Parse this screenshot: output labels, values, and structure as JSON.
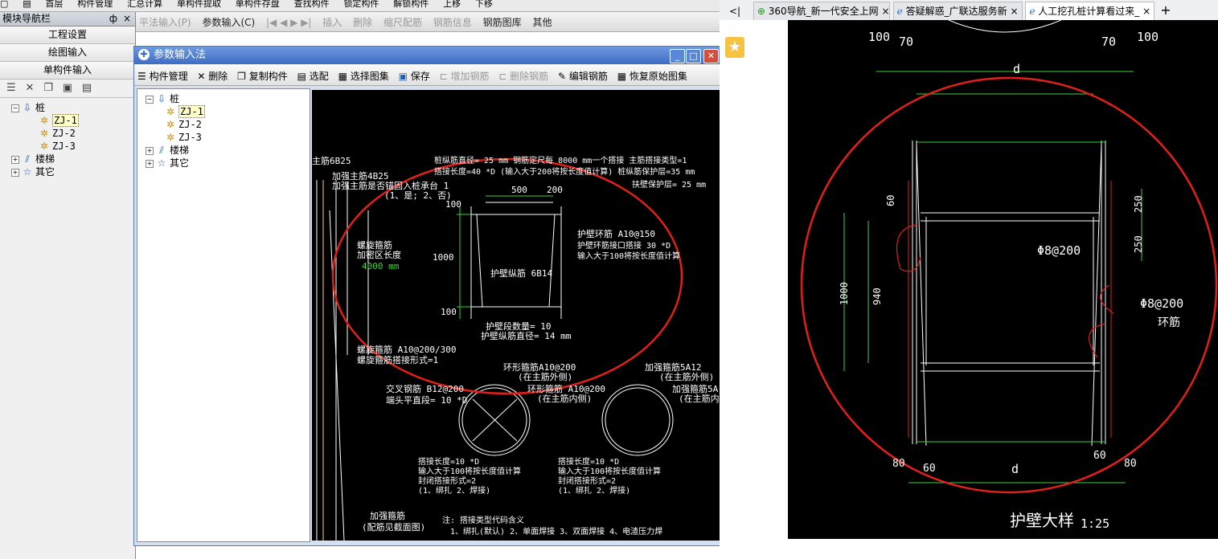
{
  "top_toolbar": {
    "items": [
      "构件管理",
      "汇总计算",
      "单构件提取",
      "单构件存盘",
      "查找构件",
      "锁定构件",
      "解锁构件",
      "上移",
      "下移"
    ],
    "combo_value": "首层"
  },
  "second_toolbar": {
    "items": [
      "平法输入(P)",
      "参数输入(C)",
      "插入",
      "删除",
      "缩尺配筋",
      "钢筋信息",
      "钢筋图库",
      "其他"
    ]
  },
  "nav": {
    "title": "模块导航栏",
    "pin": "ф",
    "close": "×",
    "buttons": [
      "工程设置",
      "绘图输入",
      "单构件输入"
    ],
    "tree": {
      "root": "桩",
      "children": [
        "ZJ-1",
        "ZJ-2",
        "ZJ-3"
      ],
      "others": [
        "楼梯",
        "其它"
      ]
    }
  },
  "dialog": {
    "title": "参数输入法",
    "tools": [
      "构件管理",
      "删除",
      "复制构件",
      "选配",
      "选择图集",
      "保存",
      "增加钢筋",
      "删除钢筋",
      "编辑钢筋",
      "恢复原始图集"
    ],
    "tree": {
      "root": "桩",
      "children": [
        "ZJ-1",
        "ZJ-2",
        "ZJ-3"
      ],
      "others": [
        "楼梯",
        "其它"
      ]
    }
  },
  "drawing": {
    "main_rebar": "主筋6B25",
    "texts": [
      "加强主筋4B25",
      "加强主筋是否锚固入桩承台 1",
      "(1、是; 2、否)",
      "桩纵筋直径= 25 mm  钢筋定尺每 8000 mm一个搭接  主筋搭接类型=1",
      "搭接长度=40 *D (输入大于200将按长度值计算) 桩纵筋保护层=35 mm",
      "扶壁保护层= 25 mm",
      "500",
      "200",
      "100",
      "1000",
      "100",
      "螺旋箍筋",
      "加密区长度",
      "4000 mm",
      "护壁环筋 A10@150",
      "护壁环筋接口搭接 30 *D",
      "输入大于100将按长度值计算",
      "护壁纵筋 6B14",
      "护壁段数量= 10",
      "护壁纵筋直径= 14 mm",
      "螺旋箍筋 A10@200/300",
      "螺旋箍筋搭接形式=1",
      "环形箍筋A10@200",
      "(在主筋外侧)",
      "交叉钢筋 B12@200",
      "端头平直段= 10 *D",
      "环形箍筋 A10@200",
      "(在主筋内侧)",
      "加强箍筋5A12",
      "(在主筋外侧)",
      "加强箍筋5A",
      "(在主筋内",
      "搭接长度=10 *D",
      "输入大于100将按长度值计算",
      "封闭搭接形式=2",
      "(1、绑扎 2、焊接)",
      "搭接长度=10 *D",
      "输入大于100将按长度值计算",
      "封闭搭接形式=2",
      "(1、绑扎 2、焊接)",
      "加强箍筋",
      "(配筋见截面图)",
      "注: 搭接类型代码含义",
      "1、绑扎(默认)  2、单面焊接  3、双面焊接  4、电渣压力焊"
    ]
  },
  "browser": {
    "back": "<|",
    "tabs": [
      {
        "label": "360导航_新一代安全上网",
        "close": "×"
      },
      {
        "label": "答疑解惑_广联达服务新",
        "close": "×"
      },
      {
        "label": "人工挖孔桩计算看过来_",
        "close": "×"
      }
    ],
    "new_tab": "+"
  },
  "cad": {
    "texts": [
      "100",
      "70",
      "70",
      "100",
      "d",
      "60",
      "250",
      "250",
      "1000",
      "940",
      "Φ8@200",
      "Φ8@200",
      "环筋",
      "80",
      "60",
      "d",
      "60",
      "80",
      "护壁大样",
      "1:25"
    ]
  }
}
